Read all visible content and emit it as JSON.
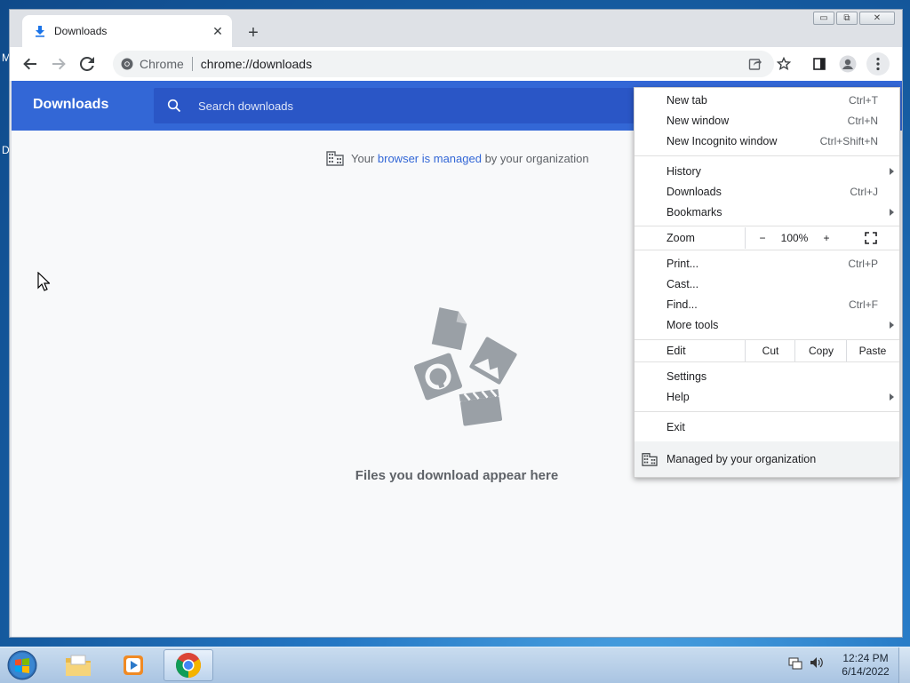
{
  "desktop": {
    "left_letters": [
      "M",
      "D"
    ]
  },
  "window": {
    "controls": {
      "minimize": "▭",
      "restore": "⧉",
      "close": "✕"
    }
  },
  "tab": {
    "title": "Downloads",
    "icon": "download-icon",
    "close": "✕"
  },
  "new_tab_label": "+",
  "omnibox": {
    "site": "Chrome",
    "url": "chrome://downloads"
  },
  "downloads": {
    "title": "Downloads",
    "search_placeholder": "Search downloads",
    "managed_prefix": "Your ",
    "managed_link": "browser is managed",
    "managed_suffix": " by your organization",
    "empty_text": "Files you download appear here"
  },
  "menu": {
    "items": [
      {
        "label": "New tab",
        "shortcut": "Ctrl+T"
      },
      {
        "label": "New window",
        "shortcut": "Ctrl+N"
      },
      {
        "label": "New Incognito window",
        "shortcut": "Ctrl+Shift+N"
      },
      {
        "label": "History",
        "shortcut": ""
      },
      {
        "label": "Downloads",
        "shortcut": "Ctrl+J"
      },
      {
        "label": "Bookmarks",
        "shortcut": ""
      },
      {
        "label": "Print...",
        "shortcut": "Ctrl+P"
      },
      {
        "label": "Cast...",
        "shortcut": ""
      },
      {
        "label": "Find...",
        "shortcut": "Ctrl+F"
      },
      {
        "label": "More tools",
        "shortcut": ""
      },
      {
        "label": "Settings",
        "shortcut": ""
      },
      {
        "label": "Help",
        "shortcut": ""
      },
      {
        "label": "Exit",
        "shortcut": ""
      }
    ],
    "zoom": {
      "label": "Zoom",
      "minus": "−",
      "value": "100%",
      "plus": "+"
    },
    "edit": {
      "label": "Edit",
      "cut": "Cut",
      "copy": "Copy",
      "paste": "Paste"
    },
    "managed": "Managed by your organization"
  },
  "taskbar": {
    "time": "12:24 PM",
    "date": "6/14/2022",
    "apps": [
      "file-explorer-icon",
      "media-player-icon",
      "chrome-icon"
    ]
  },
  "colors": {
    "accent": "#3367d6",
    "header": "#3367d6"
  }
}
